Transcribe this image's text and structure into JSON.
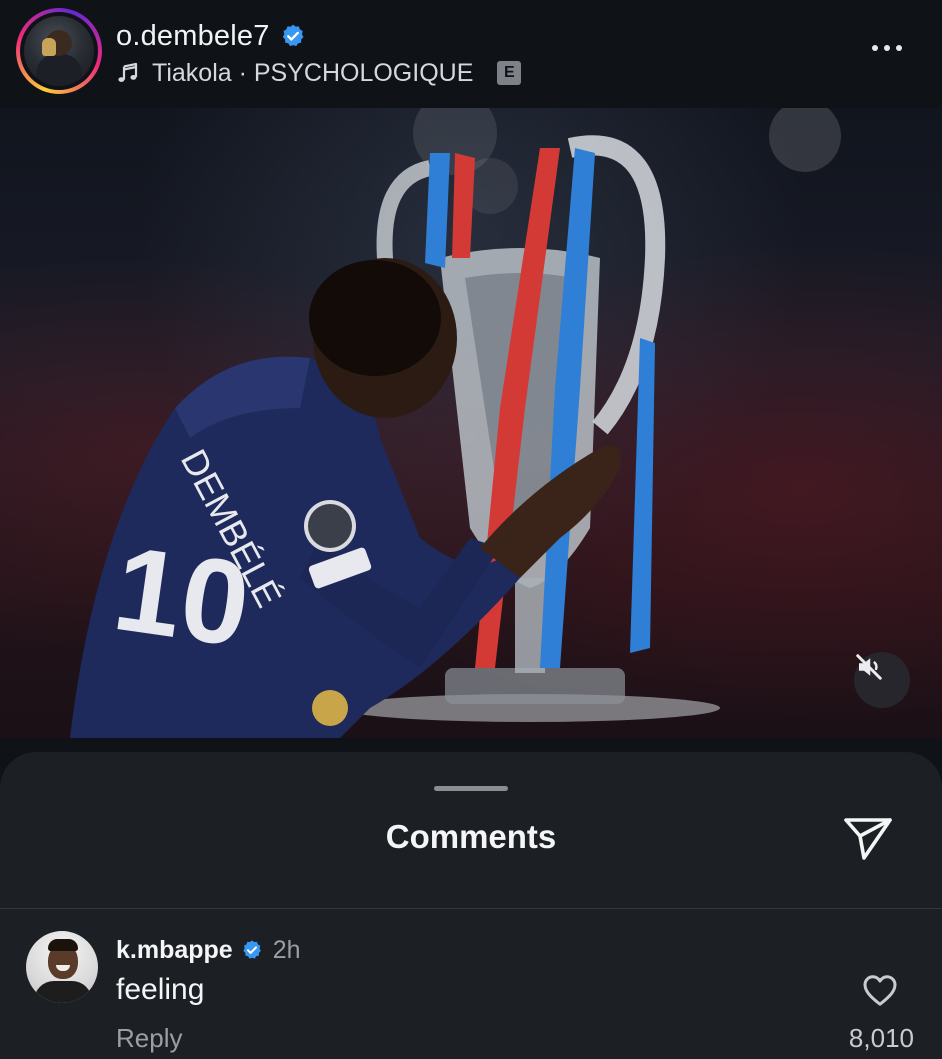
{
  "post": {
    "username": "o.dembele7",
    "music": "Tiakola · PSYCHOLOGIQUE",
    "explicit_badge": "E",
    "icons": {
      "verified": "verified-badge-icon",
      "music": "music-note-icon",
      "more": "more-options-icon",
      "mute": "speaker-muted-icon"
    },
    "colors": {
      "verified": "#3897f0",
      "background": "#0f1217"
    }
  },
  "comments_sheet": {
    "title": "Comments",
    "share_icon": "paper-plane-icon",
    "comments": [
      {
        "username": "k.mbappe",
        "verified": true,
        "time": "2h",
        "text": "feeling",
        "reply_label": "Reply",
        "likes": "8,010",
        "like_icon": "heart-outline-icon"
      }
    ]
  }
}
